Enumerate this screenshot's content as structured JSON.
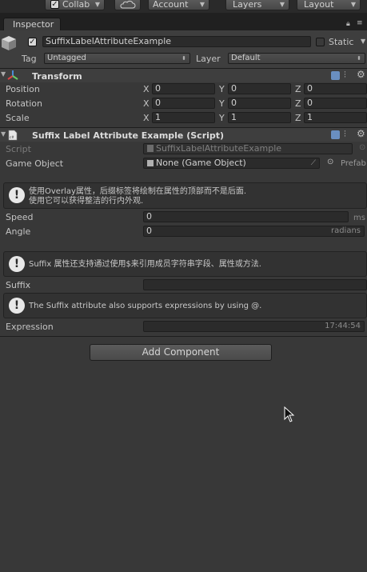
{
  "toolbar": {
    "collab_label": "Collab",
    "cloud_icon": "cloud-icon",
    "account_label": "Account",
    "layers_label": "Layers",
    "layout_label": "Layout"
  },
  "tab": {
    "label": "Inspector"
  },
  "gameobject": {
    "name": "SuffixLabelAttributeExample",
    "active_check": "✓",
    "static_label": "Static",
    "tag_label": "Tag",
    "tag_value": "Untagged",
    "layer_label": "Layer",
    "layer_value": "Default"
  },
  "transform": {
    "title": "Transform",
    "rows": [
      {
        "label": "Position",
        "x": "0",
        "y": "0",
        "z": "0"
      },
      {
        "label": "Rotation",
        "x": "0",
        "y": "0",
        "z": "0"
      },
      {
        "label": "Scale",
        "x": "1",
        "y": "1",
        "z": "1"
      }
    ],
    "axis_x": "X",
    "axis_y": "Y",
    "axis_z": "Z"
  },
  "script_component": {
    "title": "Suffix Label Attribute Example (Script)",
    "script_label": "Script",
    "script_value": "SuffixLabelAttributeExample",
    "gameobject_label": "Game Object",
    "gameobject_value": "None (Game Object)",
    "gameobject_suffix": "Prefab",
    "help1_line1": "使用Overlay属性，后缀标签将绘制在属性的顶部而不是后面.",
    "help1_line2": "使用它可以获得整洁的行内外观.",
    "speed_label": "Speed",
    "speed_value": "0",
    "speed_suffix": "ms",
    "angle_label": "Angle",
    "angle_value": "0",
    "angle_suffix": "radians",
    "help2": "Suffix 属性还支持通过使用$来引用成员字符串字段、属性或方法.",
    "suffix_label": "Suffix",
    "help3": "The Suffix attribute also supports expressions by using @.",
    "expression_label": "Expression",
    "expression_suffix": "17:44:54"
  },
  "add_component_label": "Add Component",
  "colors": {
    "background": "#383838",
    "field": "#2b2b2b",
    "header": "#3e3e3e"
  }
}
